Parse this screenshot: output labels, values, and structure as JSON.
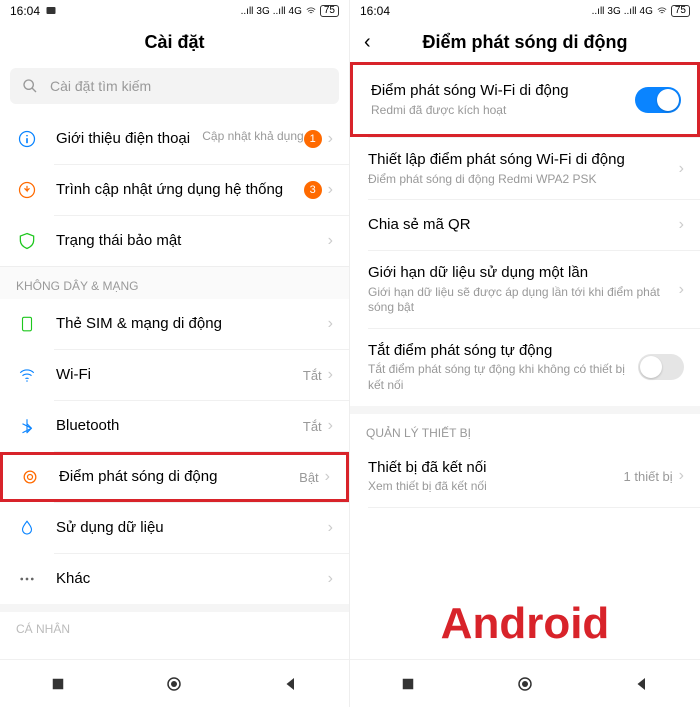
{
  "status": {
    "time": "16:04",
    "net1": "3G",
    "net2": "4G",
    "batt": "75"
  },
  "left": {
    "title": "Cài đặt",
    "searchPlaceholder": "Cài đặt tìm kiếm",
    "aboutTitle": "Giới thiệu điện thoại",
    "aboutSub": "Cập nhật khả dụng",
    "aboutBadge": "1",
    "updaterTitle": "Trình cập nhật ứng dụng hệ thống",
    "updaterBadge": "3",
    "secTitle": "Trạng thái bảo mật",
    "hdrWireless": "KHÔNG DÂY & MẠNG",
    "simTitle": "Thẻ SIM & mạng di động",
    "wifiTitle": "Wi-Fi",
    "wifiVal": "Tắt",
    "btTitle": "Bluetooth",
    "btVal": "Tắt",
    "hotspotTitle": "Điểm phát sóng di động",
    "hotspotVal": "Bật",
    "dataTitle": "Sử dụng dữ liệu",
    "moreTitle": "Khác",
    "hdrPersonal": "CÁ NHÂN"
  },
  "right": {
    "title": "Điểm phát sóng di động",
    "r1Title": "Điểm phát sóng Wi-Fi di động",
    "r1Sub": "Redmi đã được kích hoạt",
    "r2Title": "Thiết lập điểm phát sóng Wi-Fi di động",
    "r2Sub": "Điểm phát sóng di động Redmi WPA2 PSK",
    "r3Title": "Chia sẻ mã QR",
    "r4Title": "Giới hạn dữ liệu sử dụng một lần",
    "r4Sub": "Giới hạn dữ liệu sẽ được áp dụng lần tới khi điểm phát sóng bật",
    "r5Title": "Tắt điểm phát sóng tự động",
    "r5Sub": "Tắt điểm phát sóng tự động khi không có thiết bị kết nối",
    "hdrDevices": "QUẢN LÝ THIẾT BỊ",
    "r6Title": "Thiết bị đã kết nối",
    "r6Sub": "Xem thiết bị đã kết nối",
    "r6Val": "1 thiết bị",
    "watermark": "Android"
  }
}
